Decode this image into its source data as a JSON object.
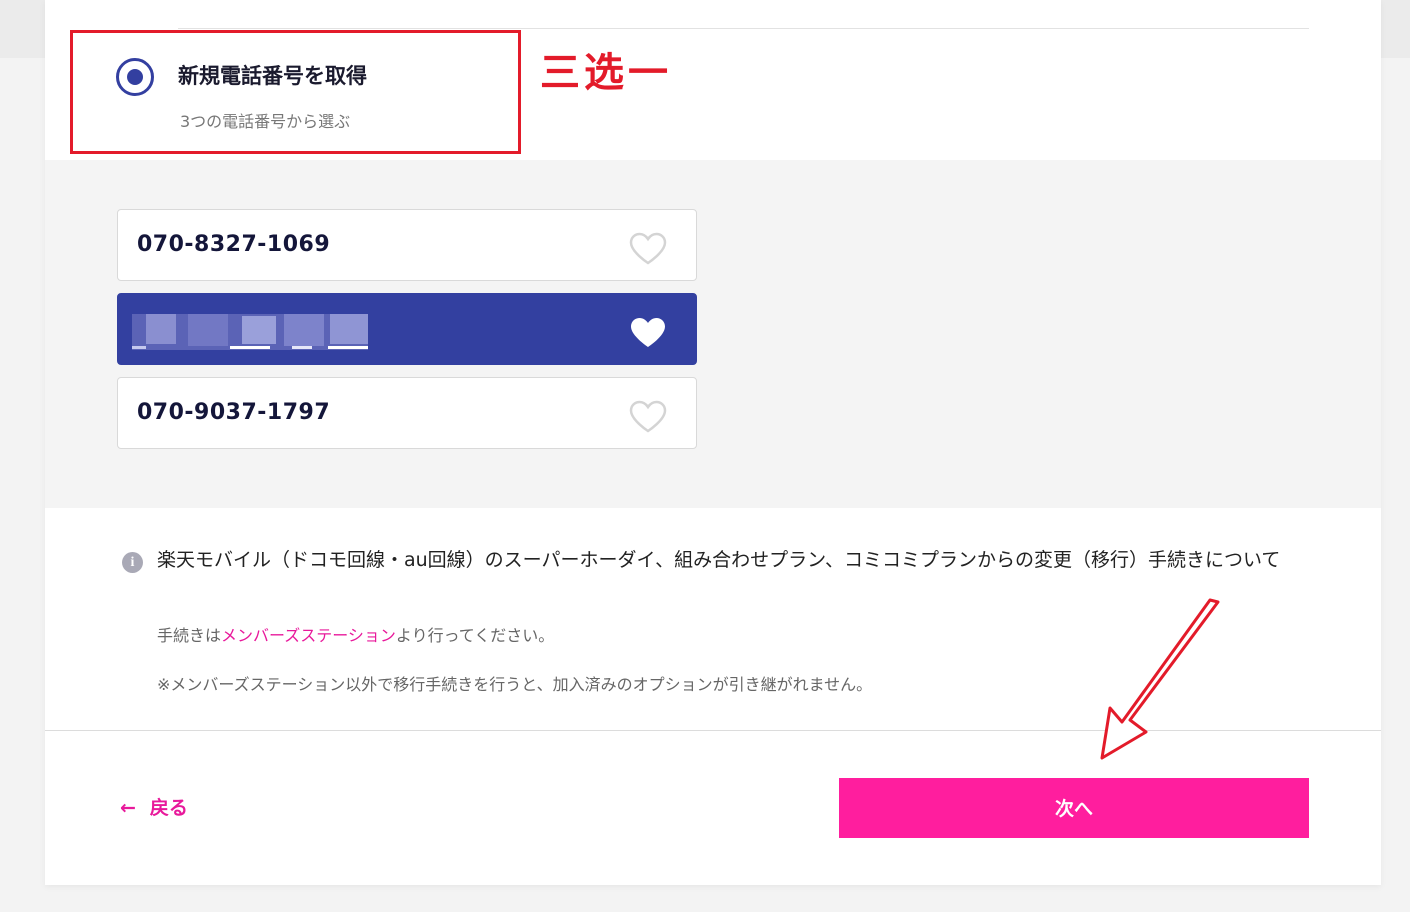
{
  "radio": {
    "title": "新規電話番号を取得",
    "subtitle": "3つの電話番号から選ぶ",
    "selected": true
  },
  "annotation": {
    "text": "三选一",
    "color": "#e31b2a"
  },
  "numbers": [
    {
      "value": "070-8327-1069",
      "selected": false
    },
    {
      "value": "",
      "selected": true,
      "blurred": true
    },
    {
      "value": "070-9037-1797",
      "selected": false
    }
  ],
  "info": {
    "title": "楽天モバイル（ドコモ回線・au回線）のスーパーホーダイ、組み合わせプラン、コミコミプランからの変更（移行）手続きについて",
    "note1_prefix": "手続きは",
    "note1_link": "メンバーズステーション",
    "note1_suffix": "より行ってください。",
    "note2": "※メンバーズステーション以外で移行手続きを行うと、加入済みのオプションが引き継がれません。"
  },
  "footer": {
    "back_label": "戻る",
    "next_label": "次へ"
  },
  "colors": {
    "brand_blue": "#3340a0",
    "accent_pink": "#ff1e9e",
    "link_pink": "#e8199b"
  }
}
